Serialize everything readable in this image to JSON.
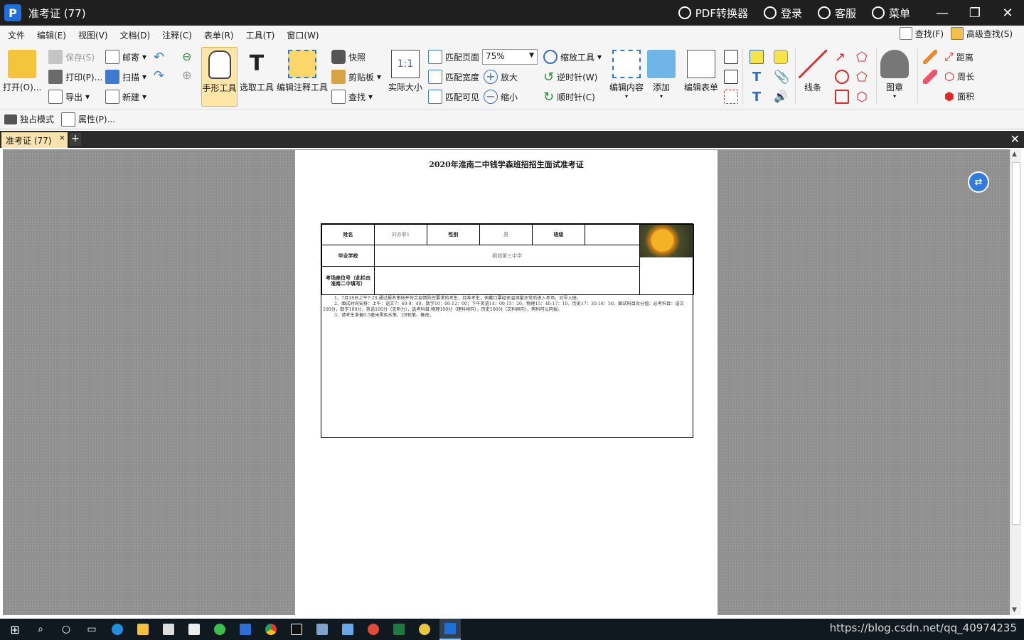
{
  "window": {
    "title": "准考证 (77)",
    "right_items": [
      "PDF转换器",
      "登录",
      "客服",
      "菜单"
    ]
  },
  "menubar": {
    "items": [
      "文件",
      "编辑(E)",
      "视图(V)",
      "文档(D)",
      "注释(C)",
      "表单(R)",
      "工具(T)",
      "窗口(W)"
    ],
    "find": "查找(F)",
    "advanced_find": "高级查找(S)"
  },
  "ribbon": {
    "open": "打开(O)...",
    "save": "保存(S)",
    "print": "打印(P)...",
    "export": "导出",
    "mail": "邮寄",
    "scan": "扫描",
    "new": "新建",
    "hand_tool": "手形工具",
    "select_tool": "选取工具",
    "edit_annot_tool": "编辑注释工具",
    "snapshot": "快照",
    "clipboard": "剪贴板",
    "search": "查找",
    "actual_size": "实际大小",
    "fit_page": "匹配页面",
    "fit_width": "匹配宽度",
    "fit_visible": "匹配可见",
    "zoom_value": "75%",
    "zoom_tool": "缩放工具",
    "zoom_in": "放大",
    "zoom_out": "缩小",
    "rotate_ccw": "逆时针(W)",
    "rotate_cw": "顺时针(C)",
    "edit_content": "编辑内容",
    "add": "添加",
    "edit_form": "编辑表单",
    "lines": "线条",
    "stamp": "图章",
    "distance": "距离",
    "perimeter": "周长",
    "area": "面积"
  },
  "toolbar2": {
    "exclusive_mode": "独占模式",
    "properties": "属性(P)..."
  },
  "tabs": {
    "doc_tab": "准考证 (77)"
  },
  "document": {
    "title": "2020年淮南二中钱学森班招招生面试准考证",
    "labels": {
      "name": "姓名",
      "gender": "性别",
      "class": "班级",
      "school": "毕业学校",
      "seat": "考场座位号（此栏由淮南二中填写）"
    },
    "values": {
      "name": "刘亦菲1",
      "gender": "男",
      "class": "",
      "school": "桐城第三中学"
    },
    "notes": [
      "1、7月18日上午7:20,通过报名审核并符合疫情防控要求的考生，持准考生，佩戴口罩经体温测量正常后进入考场，对号入座。",
      "2、面试时间安排：上午：语文7：40-9：40，数学10：00-12：00；下午英语14：00-15：20，物理15：40-17：10，历史17：30-18：50。面试科目及分值：必考科目：语文100分，数学100分，英语100分（无听力），选考科目:物理100分（理科倾向），历史100分（文科倾向），两科可以同报。",
      "3、请考生准备0.5毫米黑色水笔、2B铅笔、橡皮。"
    ]
  },
  "watermark": "https://blog.csdn.net/qq_40974235"
}
